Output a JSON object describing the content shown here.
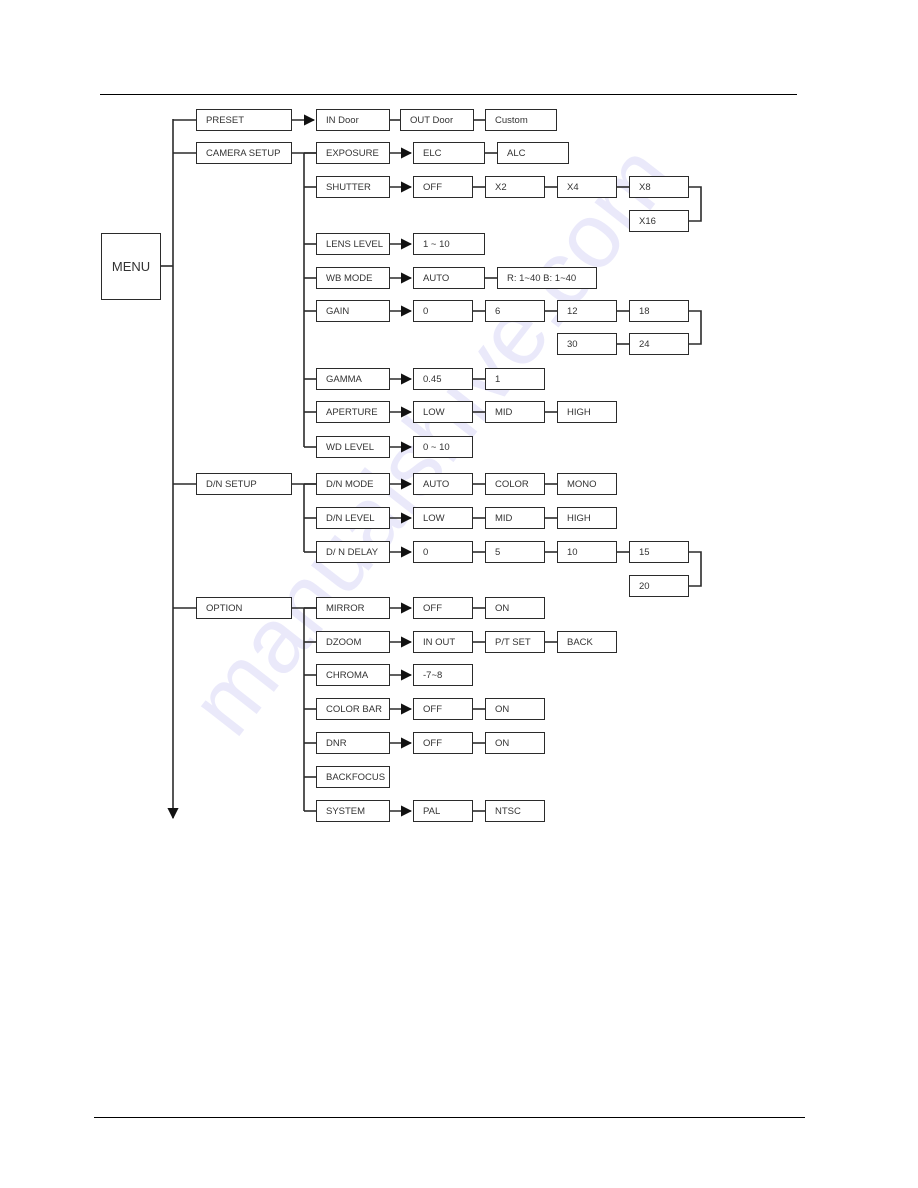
{
  "root": {
    "label": "MENU"
  },
  "watermark": "manualshive.com",
  "menus": [
    {
      "key": "preset",
      "label": "PRESET",
      "options": [
        "IN Door",
        "OUT Door",
        "Custom"
      ]
    },
    {
      "key": "camera-setup",
      "label": "CAMERA SETUP",
      "items": [
        {
          "key": "exposure",
          "label": "EXPOSURE",
          "options": [
            "ELC",
            "ALC"
          ]
        },
        {
          "key": "shutter",
          "label": "SHUTTER",
          "options": [
            "OFF",
            "X2",
            "X4",
            "X8",
            "X16"
          ]
        },
        {
          "key": "lens-level",
          "label": "LENS LEVEL",
          "options": [
            "1 ~ 10"
          ]
        },
        {
          "key": "wb-mode",
          "label": "WB MODE",
          "options": [
            "AUTO",
            "R: 1~40 B: 1~40"
          ]
        },
        {
          "key": "gain",
          "label": "GAIN",
          "options": [
            "0",
            "6",
            "12",
            "18",
            "24",
            "30"
          ]
        },
        {
          "key": "gamma",
          "label": "GAMMA",
          "options": [
            "0.45",
            "1"
          ]
        },
        {
          "key": "aperture",
          "label": "APERTURE",
          "options": [
            "LOW",
            "MID",
            "HIGH"
          ]
        },
        {
          "key": "wd-level",
          "label": "WD LEVEL",
          "options": [
            "0 ~ 10"
          ]
        }
      ]
    },
    {
      "key": "dn-setup",
      "label": "D/N SETUP",
      "items": [
        {
          "key": "dn-mode",
          "label": "D/N MODE",
          "options": [
            "AUTO",
            "COLOR",
            "MONO"
          ]
        },
        {
          "key": "dn-level",
          "label": "D/N LEVEL",
          "options": [
            "LOW",
            "MID",
            "HIGH"
          ]
        },
        {
          "key": "dn-delay",
          "label": "D/ N DELAY",
          "options": [
            "0",
            "5",
            "10",
            "15",
            "20"
          ]
        }
      ]
    },
    {
      "key": "option",
      "label": "OPTION",
      "items": [
        {
          "key": "mirror",
          "label": "MIRROR",
          "options": [
            "OFF",
            "ON"
          ]
        },
        {
          "key": "dzoom",
          "label": "DZOOM",
          "options": [
            "IN OUT",
            "P/T SET",
            "BACK"
          ]
        },
        {
          "key": "chroma",
          "label": "CHROMA",
          "options": [
            "-7~8"
          ]
        },
        {
          "key": "color-bar",
          "label": "COLOR BAR",
          "options": [
            "OFF",
            "ON"
          ]
        },
        {
          "key": "dnr",
          "label": "DNR",
          "options": [
            "OFF",
            "ON"
          ]
        },
        {
          "key": "backfocus",
          "label": "BACKFOCUS",
          "options": []
        },
        {
          "key": "system",
          "label": "SYSTEM",
          "options": [
            "PAL",
            "NTSC"
          ]
        }
      ]
    }
  ]
}
